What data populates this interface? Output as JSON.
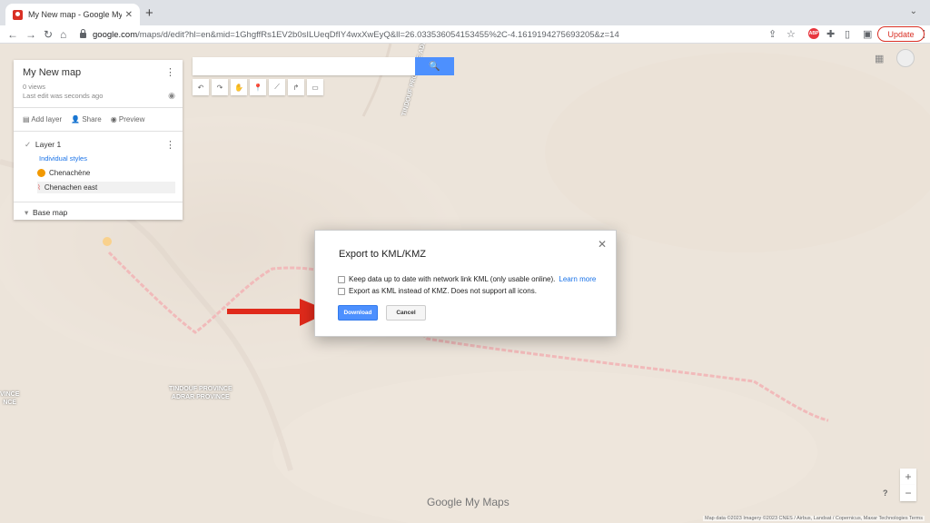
{
  "browser": {
    "tab_title": "My New map - Google My Map",
    "tab_close": "✕",
    "new_tab": "+",
    "tab_menu": "⌄",
    "url_domain": "google.com",
    "url_rest": "/maps/d/edit?hl=en&mid=1GhgffRs1EV2b0sILUeqDfIY4wxXwEyQ&ll=26.033536054153455%2C-4.1619194275693205&z=14",
    "back": "←",
    "forward": "→",
    "reload": "↻",
    "home": "⌂",
    "share_icon": "⇪",
    "star_icon": "☆",
    "abp_label": "ABP",
    "puzzle_icon": "✚",
    "sidebar_icon": "▯",
    "profile_icon": "▣",
    "update_label": "Update",
    "menu_icon": "⋮"
  },
  "panel": {
    "map_title": "My New map",
    "views": "0 views",
    "last_edit": "Last edit was seconds ago",
    "add_layer": "Add layer",
    "share": "Share",
    "preview": "Preview",
    "layer_name": "Layer 1",
    "styles_label": "Individual styles",
    "features": [
      "Chenachène",
      "Chenachen east"
    ],
    "base_map": "Base map"
  },
  "map": {
    "search_icon": "🔍",
    "labels": {
      "tindouf_top": "TINDOUF PROVINCE\nADRAR PROVINCE",
      "tindouf_bottom": "TINDOUF PROVINCE\nADRAR PROVINCE",
      "province_left": "VINCE\nNCE"
    },
    "branding": "Google My Maps",
    "attribution": "Map data ©2023 Imagery ©2023 CNES / Airbus, Landsat / Copernicus, Maxar Technologies   Terms",
    "zoom_in": "+",
    "zoom_out": "−",
    "help": "?"
  },
  "dialog": {
    "title": "Export to KML/KMZ",
    "close": "✕",
    "option1": "Keep data up to date with network link KML (only usable online).",
    "learn_more": "Learn more",
    "option2": "Export as KML instead of KMZ. Does not support all icons.",
    "download": "Download",
    "cancel": "Cancel"
  },
  "colors": {
    "accent_blue": "#4d90fe",
    "arrow_red": "#e02a1b",
    "route_red": "#e06666",
    "update_red": "#d93025"
  }
}
